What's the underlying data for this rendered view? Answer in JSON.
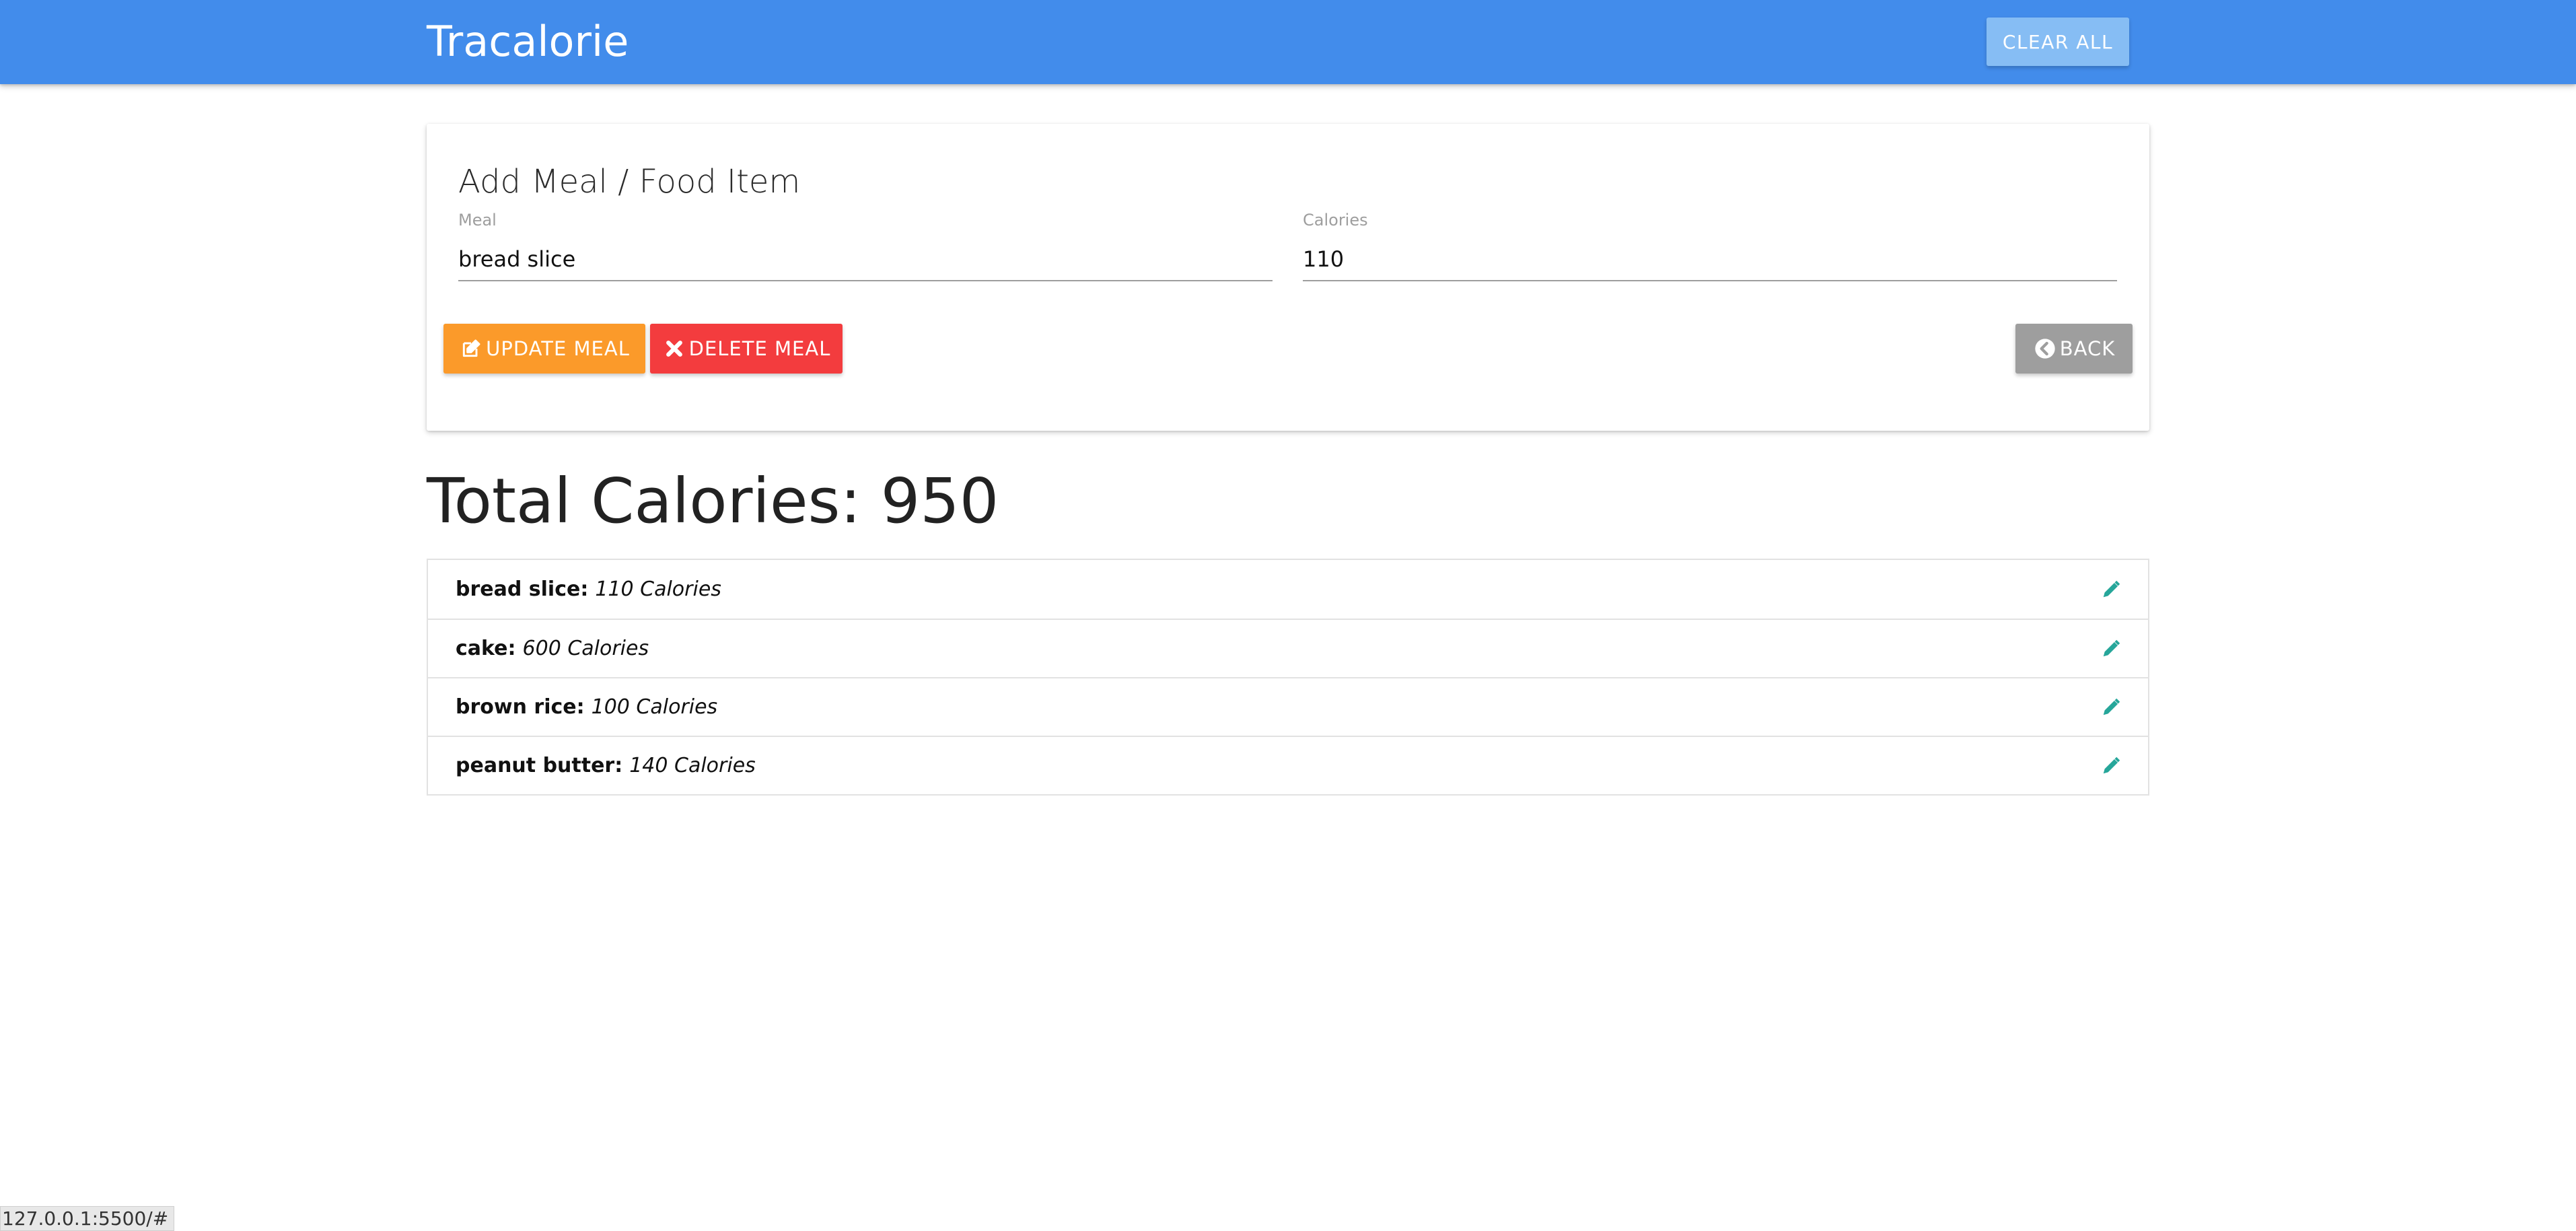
{
  "navbar": {
    "brand": "Tracalorie",
    "clear_all_label": "CLEAR ALL"
  },
  "form": {
    "title": "Add Meal / Food Item",
    "meal_label": "Meal",
    "meal_value": "bread slice",
    "calories_label": "Calories",
    "calories_value": "110",
    "update_label": "UPDATE MEAL",
    "delete_label": "DELETE MEAL",
    "back_label": "BACK"
  },
  "total": {
    "text": "Total Calories: 950"
  },
  "items": [
    {
      "name": "bread slice:",
      "calories": "110 Calories"
    },
    {
      "name": "cake:",
      "calories": "600 Calories"
    },
    {
      "name": "brown rice:",
      "calories": "100 Calories"
    },
    {
      "name": "peanut butter:",
      "calories": "140 Calories"
    }
  ],
  "status_bar": {
    "url": "127.0.0.1:5500/#"
  },
  "colors": {
    "navbar": "#428ceb",
    "update_button": "#fb9a2a",
    "delete_button": "#f33c3e",
    "back_button": "#9e9e9e",
    "edit_icon": "#26a69a"
  },
  "icons": {
    "update": "edit-icon",
    "delete": "close-icon",
    "back": "chevron-left-circle-icon",
    "item_edit": "pencil-icon"
  }
}
